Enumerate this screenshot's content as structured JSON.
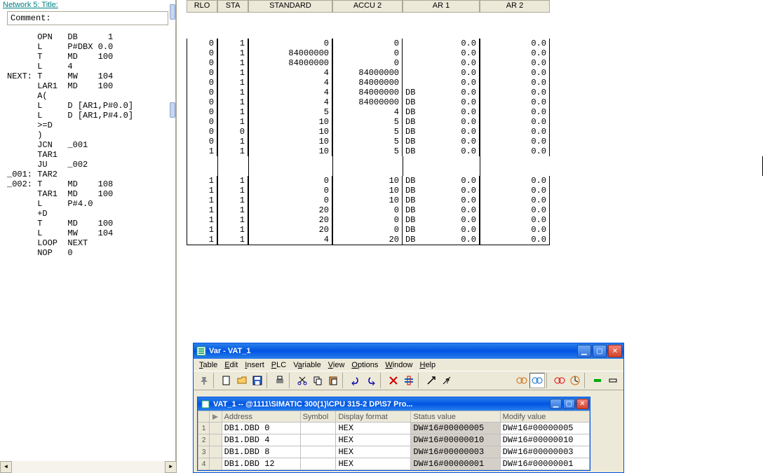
{
  "left_panel": {
    "title_strip": "Network 5: Title:",
    "comment_label": "Comment:",
    "code_lines": [
      "      OPN   DB      1",
      "      L     P#DBX 0.0",
      "      T     MD    100",
      "      L     4",
      "NEXT: T     MW    104",
      "      LAR1  MD    100",
      "      A(",
      "      L     D [AR1,P#0.0]",
      "      L     D [AR1,P#4.0]",
      "      >=D",
      "      )",
      "      JCN   _001",
      "      TAR1",
      "      JU    _002",
      "_001: TAR2",
      "_002: T     MD    108",
      "      TAR1  MD    100",
      "      L     P#4.0",
      "      +D",
      "      T     MD    100",
      "      L     MW    104",
      "      LOOP  NEXT",
      "      NOP   0"
    ]
  },
  "status_table": {
    "headers": {
      "rlo": "RLO",
      "sta": "STA",
      "standard": "STANDARD",
      "accu2": "ACCU 2",
      "ar1": "AR 1",
      "ar2": "AR 2"
    },
    "group1": [
      {
        "rlo": "0",
        "sta": "1",
        "std": "0",
        "acc2": "0",
        "db": "",
        "ar1": "0.0",
        "ar2": "0.0"
      },
      {
        "rlo": "0",
        "sta": "1",
        "std": "84000000",
        "acc2": "0",
        "db": "",
        "ar1": "0.0",
        "ar2": "0.0"
      },
      {
        "rlo": "0",
        "sta": "1",
        "std": "84000000",
        "acc2": "0",
        "db": "",
        "ar1": "0.0",
        "ar2": "0.0"
      },
      {
        "rlo": "0",
        "sta": "1",
        "std": "4",
        "acc2": "84000000",
        "db": "",
        "ar1": "0.0",
        "ar2": "0.0"
      },
      {
        "rlo": "0",
        "sta": "1",
        "std": "4",
        "acc2": "84000000",
        "db": "",
        "ar1": "0.0",
        "ar2": "0.0"
      },
      {
        "rlo": "0",
        "sta": "1",
        "std": "4",
        "acc2": "84000000",
        "db": "DB",
        "ar1": "0.0",
        "ar2": "0.0"
      },
      {
        "rlo": "0",
        "sta": "1",
        "std": "4",
        "acc2": "84000000",
        "db": "DB",
        "ar1": "0.0",
        "ar2": "0.0"
      },
      {
        "rlo": "0",
        "sta": "1",
        "std": "5",
        "acc2": "4",
        "db": "DB",
        "ar1": "0.0",
        "ar2": "0.0"
      },
      {
        "rlo": "0",
        "sta": "1",
        "std": "10",
        "acc2": "5",
        "db": "DB",
        "ar1": "0.0",
        "ar2": "0.0"
      },
      {
        "rlo": "0",
        "sta": "0",
        "std": "10",
        "acc2": "5",
        "db": "DB",
        "ar1": "0.0",
        "ar2": "0.0"
      },
      {
        "rlo": "0",
        "sta": "1",
        "std": "10",
        "acc2": "5",
        "db": "DB",
        "ar1": "0.0",
        "ar2": "0.0"
      },
      {
        "rlo": "1",
        "sta": "1",
        "std": "10",
        "acc2": "5",
        "db": "DB",
        "ar1": "0.0",
        "ar2": "0.0"
      }
    ],
    "group2": [
      {
        "rlo": "1",
        "sta": "1",
        "std": "0",
        "acc2": "10",
        "db": "DB",
        "ar1": "0.0",
        "ar2": "0.0"
      },
      {
        "rlo": "1",
        "sta": "1",
        "std": "0",
        "acc2": "10",
        "db": "DB",
        "ar1": "0.0",
        "ar2": "0.0"
      },
      {
        "rlo": "1",
        "sta": "1",
        "std": "0",
        "acc2": "10",
        "db": "DB",
        "ar1": "0.0",
        "ar2": "0.0"
      },
      {
        "rlo": "1",
        "sta": "1",
        "std": "20",
        "acc2": "0",
        "db": "DB",
        "ar1": "0.0",
        "ar2": "0.0"
      },
      {
        "rlo": "1",
        "sta": "1",
        "std": "20",
        "acc2": "0",
        "db": "DB",
        "ar1": "0.0",
        "ar2": "0.0"
      },
      {
        "rlo": "1",
        "sta": "1",
        "std": "20",
        "acc2": "0",
        "db": "DB",
        "ar1": "0.0",
        "ar2": "0.0"
      },
      {
        "rlo": "1",
        "sta": "1",
        "std": "4",
        "acc2": "20",
        "db": "DB",
        "ar1": "0.0",
        "ar2": "0.0"
      }
    ]
  },
  "vat": {
    "title": "Var - VAT_1",
    "menu": {
      "table": "Table",
      "edit": "Edit",
      "insert": "Insert",
      "plc": "PLC",
      "variable": "Variable",
      "view": "View",
      "options": "Options",
      "window": "Window",
      "help": "Help"
    },
    "inner_title": "VAT_1 -- @1111\\SIMATIC 300(1)\\CPU 315-2 DP\\S7 Pro...",
    "grid_headers": {
      "addr": "Address",
      "sym": "Symbol",
      "fmt": "Display format",
      "stv": "Status value",
      "mdv": "Modify value"
    },
    "rows": [
      {
        "n": "1",
        "addr": "DB1.DBD    0",
        "sym": "",
        "fmt": "HEX",
        "stv": "DW#16#00000005",
        "mdv": "DW#16#00000005"
      },
      {
        "n": "2",
        "addr": "DB1.DBD    4",
        "sym": "",
        "fmt": "HEX",
        "stv": "DW#16#00000010",
        "mdv": "DW#16#00000010"
      },
      {
        "n": "3",
        "addr": "DB1.DBD    8",
        "sym": "",
        "fmt": "HEX",
        "stv": "DW#16#00000003",
        "mdv": "DW#16#00000003"
      },
      {
        "n": "4",
        "addr": "DB1.DBD   12",
        "sym": "",
        "fmt": "HEX",
        "stv": "DW#16#00000001",
        "mdv": "DW#16#00000001"
      }
    ]
  }
}
